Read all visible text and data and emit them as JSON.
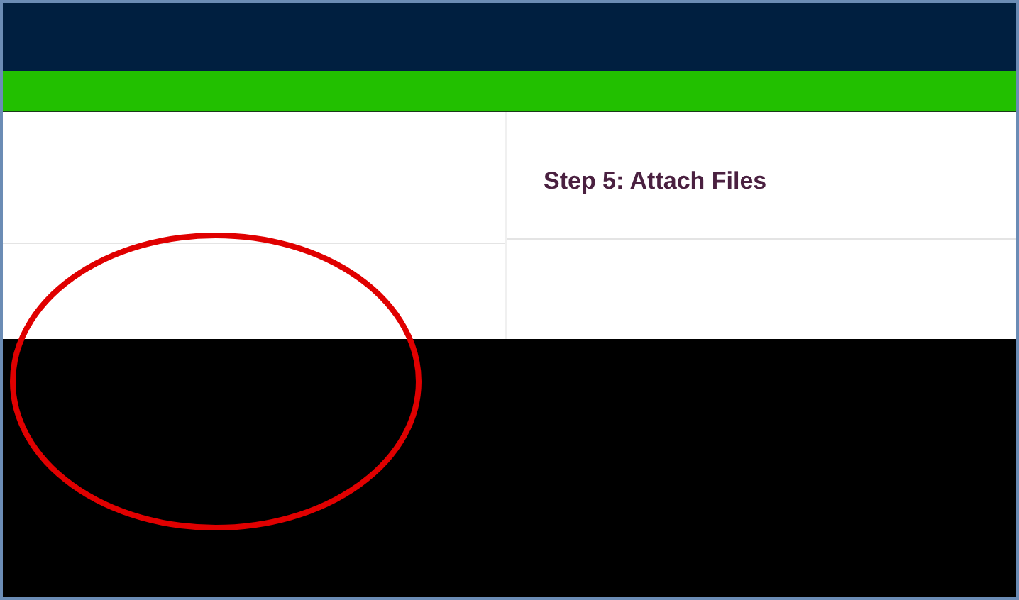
{
  "step_heading": "Step 5: Attach Files"
}
